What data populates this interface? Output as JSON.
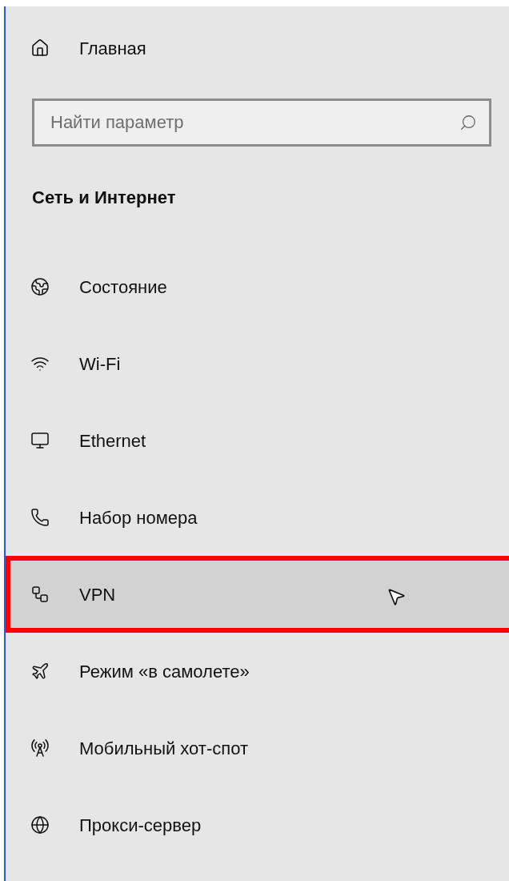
{
  "home": {
    "label": "Главная"
  },
  "search": {
    "placeholder": "Найти параметр"
  },
  "section": {
    "title": "Сеть и Интернет"
  },
  "items": [
    {
      "label": "Состояние",
      "highlighted": false
    },
    {
      "label": "Wi-Fi",
      "highlighted": false
    },
    {
      "label": "Ethernet",
      "highlighted": false
    },
    {
      "label": "Набор номера",
      "highlighted": false
    },
    {
      "label": "VPN",
      "highlighted": true
    },
    {
      "label": "Режим «в самолете»",
      "highlighted": false
    },
    {
      "label": "Мобильный хот-спот",
      "highlighted": false
    },
    {
      "label": "Прокси-сервер",
      "highlighted": false
    }
  ]
}
